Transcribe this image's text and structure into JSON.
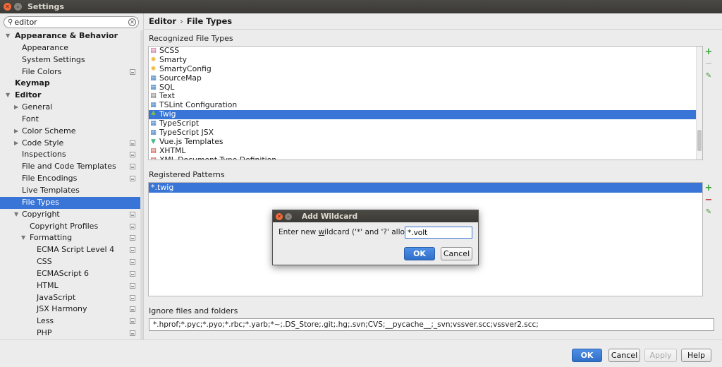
{
  "window": {
    "title": "Settings"
  },
  "search": {
    "value": "editor"
  },
  "tree": [
    {
      "label": "Appearance & Behavior",
      "level": 0,
      "arrow": "down",
      "bold": true
    },
    {
      "label": "Appearance",
      "level": 1
    },
    {
      "label": "System Settings",
      "level": 1
    },
    {
      "label": "File Colors",
      "level": 1,
      "project": true
    },
    {
      "label": "Keymap",
      "level": 0,
      "bold": true
    },
    {
      "label": "Editor",
      "level": 0,
      "arrow": "down",
      "bold": true
    },
    {
      "label": "General",
      "level": 1,
      "arrow": "right"
    },
    {
      "label": "Font",
      "level": 1
    },
    {
      "label": "Color Scheme",
      "level": 1,
      "arrow": "right"
    },
    {
      "label": "Code Style",
      "level": 1,
      "arrow": "right",
      "project": true
    },
    {
      "label": "Inspections",
      "level": 1,
      "project": true
    },
    {
      "label": "File and Code Templates",
      "level": 1,
      "project": true
    },
    {
      "label": "File Encodings",
      "level": 1,
      "project": true
    },
    {
      "label": "Live Templates",
      "level": 1
    },
    {
      "label": "File Types",
      "level": 1,
      "selected": true
    },
    {
      "label": "Copyright",
      "level": 1,
      "arrow": "down",
      "project": true
    },
    {
      "label": "Copyright Profiles",
      "level": 2,
      "project": true
    },
    {
      "label": "Formatting",
      "level": 2,
      "arrow": "down",
      "project": true
    },
    {
      "label": "ECMA Script Level 4",
      "level": 3,
      "project": true
    },
    {
      "label": "CSS",
      "level": 3,
      "project": true
    },
    {
      "label": "ECMAScript 6",
      "level": 3,
      "project": true
    },
    {
      "label": "HTML",
      "level": 3,
      "project": true
    },
    {
      "label": "JavaScript",
      "level": 3,
      "project": true
    },
    {
      "label": "JSX Harmony",
      "level": 3,
      "project": true
    },
    {
      "label": "Less",
      "level": 3,
      "project": true
    },
    {
      "label": "PHP",
      "level": 3,
      "project": true
    }
  ],
  "breadcrumb": {
    "parent": "Editor",
    "sep": "›",
    "current": "File Types"
  },
  "recognized": {
    "title": "Recognized File Types",
    "items": [
      {
        "label": "SCSS",
        "icon": "scss-icon",
        "glyph": "▤",
        "color": "#c6538c"
      },
      {
        "label": "Smarty",
        "icon": "smarty-icon",
        "glyph": "✺",
        "color": "#f0b42c"
      },
      {
        "label": "SmartyConfig",
        "icon": "smarty-config-icon",
        "glyph": "✺",
        "color": "#f0b42c"
      },
      {
        "label": "SourceMap",
        "icon": "sourcemap-icon",
        "glyph": "▦",
        "color": "#3a7bbf"
      },
      {
        "label": "SQL",
        "icon": "sql-icon",
        "glyph": "▦",
        "color": "#3a7bbf"
      },
      {
        "label": "Text",
        "icon": "text-icon",
        "glyph": "▤",
        "color": "#666666"
      },
      {
        "label": "TSLint Configuration",
        "icon": "tslint-icon",
        "glyph": "▦",
        "color": "#3a7bbf"
      },
      {
        "label": "Twig",
        "icon": "twig-icon",
        "glyph": "♣",
        "color": "#86c43a",
        "selected": true
      },
      {
        "label": "TypeScript",
        "icon": "typescript-icon",
        "glyph": "▦",
        "color": "#3a7bbf"
      },
      {
        "label": "TypeScript JSX",
        "icon": "typescript-jsx-icon",
        "glyph": "▦",
        "color": "#3a7bbf"
      },
      {
        "label": "Vue.js Templates",
        "icon": "vue-icon",
        "glyph": "▼",
        "color": "#41b883"
      },
      {
        "label": "XHTML",
        "icon": "xhtml-icon",
        "glyph": "▤",
        "color": "#c0392b"
      },
      {
        "label": "XML Document Type Definition",
        "icon": "dtd-icon",
        "glyph": "▤",
        "color": "#c0392b"
      }
    ]
  },
  "patterns": {
    "title": "Registered Patterns",
    "items": [
      "*.twig"
    ]
  },
  "ignore": {
    "title": "Ignore files and folders",
    "value": "*.hprof;*.pyc;*.pyo;*.rbc;*.yarb;*~;.DS_Store;.git;.hg;.svn;CVS;__pycache__;_svn;vssver.scc;vssver2.scc;"
  },
  "buttons": {
    "ok": "OK",
    "cancel": "Cancel",
    "apply": "Apply",
    "help": "Help"
  },
  "dialog": {
    "title": "Add Wildcard",
    "prompt_before": "Enter new ",
    "prompt_u": "w",
    "prompt_after": "ildcard ('*' and '?' allowed):",
    "value": "*.volt",
    "ok": "OK",
    "cancel": "Cancel"
  },
  "colors": {
    "accent": "#3875d7",
    "titlebar": "#3c3b37"
  }
}
